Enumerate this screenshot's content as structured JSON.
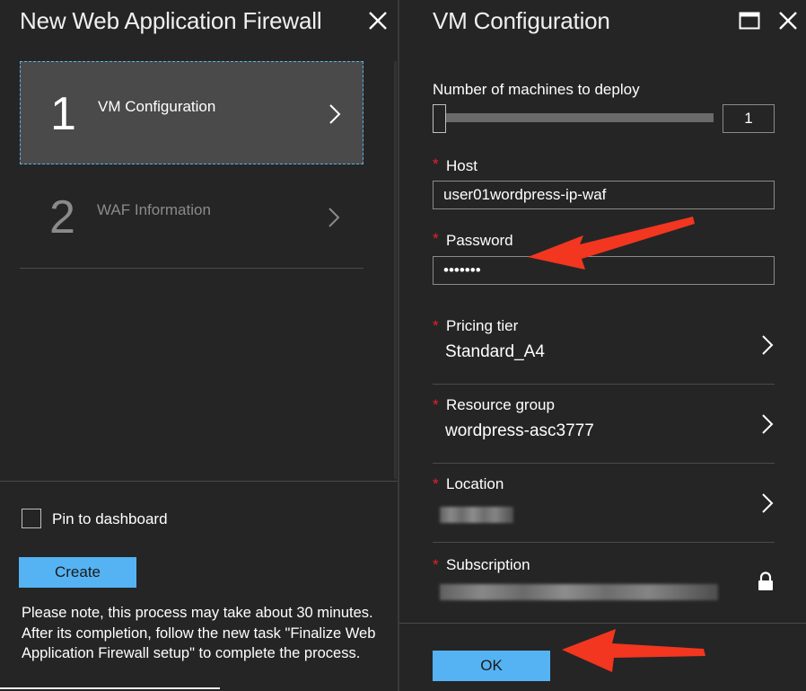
{
  "left_blade": {
    "title": "New Web Application Firewall",
    "steps": [
      {
        "number": "1",
        "label": "VM Configuration"
      },
      {
        "number": "2",
        "label": "WAF Information"
      }
    ],
    "pin_label": "Pin to dashboard",
    "pin_checked": false,
    "create_label": "Create",
    "note": "Please note, this process may take about 30 minutes. After its completion, follow the new task \"Finalize Web Application Firewall setup\" to complete the process."
  },
  "right_blade": {
    "title": "VM Configuration",
    "machines": {
      "label": "Number of machines to deploy",
      "value": "1"
    },
    "required_marker": "*",
    "host": {
      "label": "Host",
      "value": "user01wordpress-ip-waf"
    },
    "password": {
      "label": "Password",
      "value": "•••••••"
    },
    "pricing_tier": {
      "label": "Pricing tier",
      "value": "Standard_A4"
    },
    "resource_group": {
      "label": "Resource group",
      "value": "wordpress-asc3777"
    },
    "location": {
      "label": "Location"
    },
    "subscription": {
      "label": "Subscription"
    },
    "ok_label": "OK"
  },
  "colors": {
    "background": "#252526",
    "accent_button": "#55b3f3",
    "selected_step": "#4a4a4a",
    "focus_border": "#58b4e6",
    "required": "#e8202a",
    "annotation_arrow": "#f2361f"
  },
  "icons": {
    "close": "close-icon",
    "maximize": "maximize-icon",
    "chevron": "chevron-right-icon",
    "lock": "lock-icon"
  }
}
